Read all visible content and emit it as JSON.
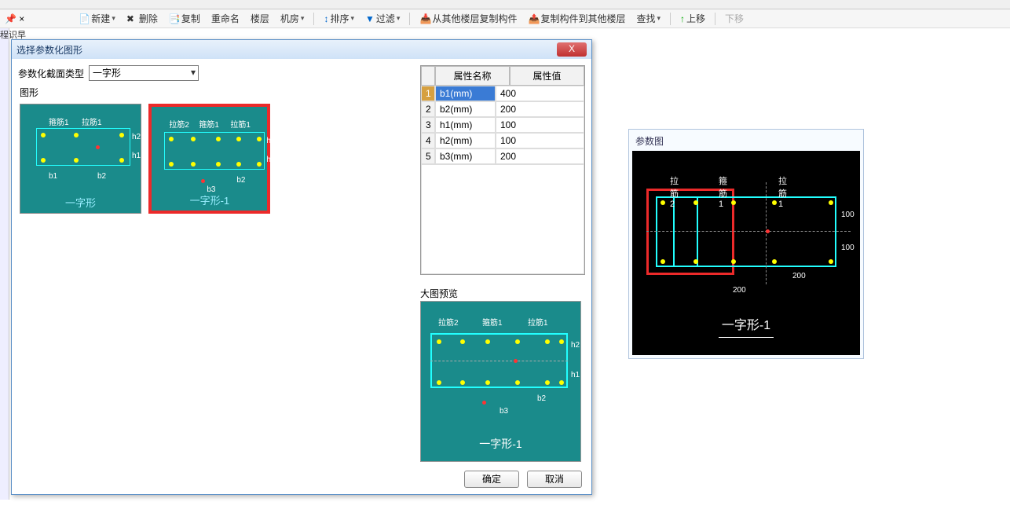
{
  "toolbar2": {
    "new": "新建",
    "delete": "删除",
    "copy": "复制",
    "rename": "重命名",
    "floor": "楼层",
    "room": "机房",
    "sort": "排序",
    "filter": "过滤",
    "copy_from_floor": "从其他楼层复制构件",
    "copy_to_floor": "复制构件到其他楼层",
    "find": "查找",
    "up": "上移",
    "down": "下移"
  },
  "left_label": "程识早",
  "dialog": {
    "title": "选择参数化图形",
    "type_label": "参数化截面类型",
    "type_value": "一字形",
    "shapes_label": "图形",
    "thumb1": "一字形",
    "thumb2": "一字形-1",
    "preview_label": "大图预览",
    "preview_caption": "一字形-1",
    "ok": "确定",
    "cancel": "取消"
  },
  "prop": {
    "head_name": "属性名称",
    "head_value": "属性值",
    "rows": [
      {
        "i": "1",
        "n": "b1(mm)",
        "v": "400"
      },
      {
        "i": "2",
        "n": "b2(mm)",
        "v": "200"
      },
      {
        "i": "3",
        "n": "h1(mm)",
        "v": "100"
      },
      {
        "i": "4",
        "n": "h2(mm)",
        "v": "100"
      },
      {
        "i": "5",
        "n": "b3(mm)",
        "v": "200"
      }
    ]
  },
  "right": {
    "title": "参数图",
    "caption": "一字形-1",
    "lbl_lajin2": "拉筋2",
    "lbl_gujin1": "箍筋1",
    "lbl_lajin1": "拉筋1",
    "dim_100a": "100",
    "dim_100b": "100",
    "dim_200a": "200",
    "dim_200b": "200"
  },
  "thumb_labels": {
    "gujin1": "箍筋1",
    "lajin1": "拉筋1",
    "lajin2": "拉筋2",
    "b1": "b1",
    "b2": "b2",
    "b3": "b3",
    "h1": "h1",
    "h2": "h2"
  },
  "preview_labels": {
    "lajin2": "拉筋2",
    "gujin1": "箍筋1",
    "lajin1": "拉筋1",
    "b2": "b2",
    "b3": "b3",
    "h1": "h1",
    "h2": "h2"
  }
}
